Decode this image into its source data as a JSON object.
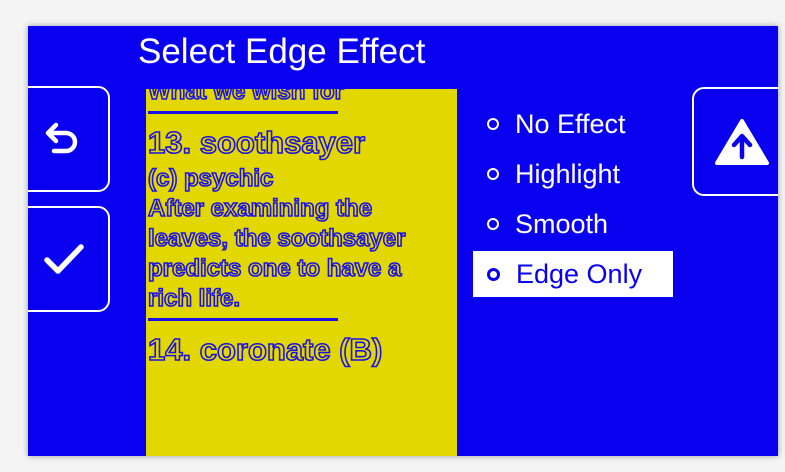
{
  "dialog": {
    "title": "Select Edge Effect"
  },
  "buttons": {
    "back_icon": "undo-arrow-icon",
    "confirm_icon": "checkmark-icon",
    "up_icon": "up-arrow-icon"
  },
  "preview": {
    "lines": [
      "What we wish for",
      "13. soothsayer",
      "(c) psychic",
      "After examining the",
      "leaves, the soothsayer",
      "predicts one to have a",
      "rich life.",
      "14. coronate (B)"
    ]
  },
  "options": [
    {
      "label": "No Effect",
      "selected": false
    },
    {
      "label": "Highlight",
      "selected": false
    },
    {
      "label": "Smooth",
      "selected": false
    },
    {
      "label": "Edge Only",
      "selected": true
    }
  ],
  "colors": {
    "background": "#0a00f0",
    "preview_bg": "#e3d700",
    "text": "#ffffff"
  }
}
